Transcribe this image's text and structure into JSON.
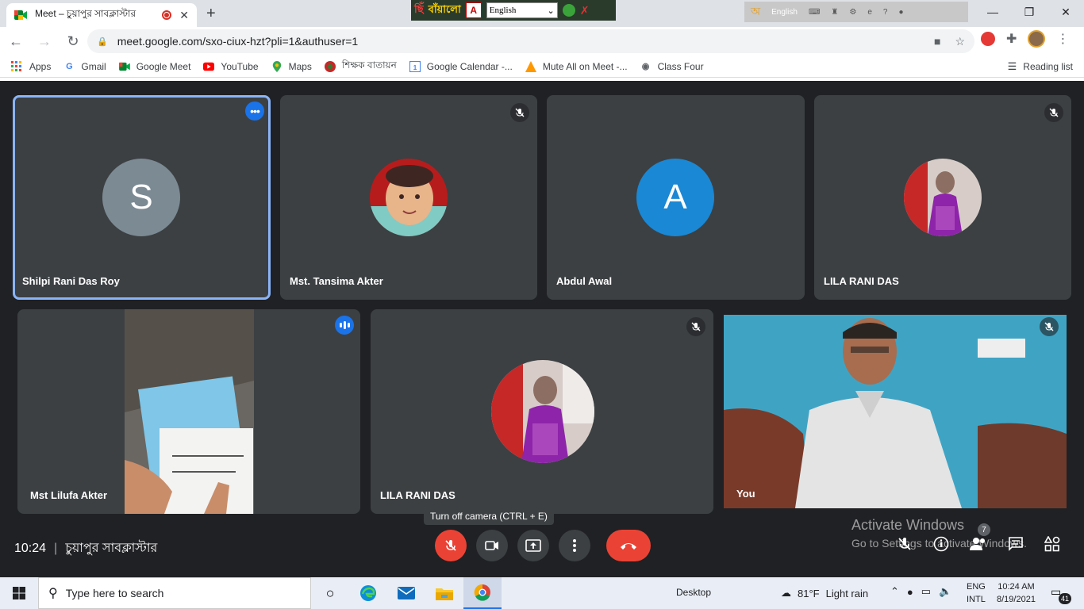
{
  "browser": {
    "tab_title": "Meet – চুয়াপুর সাবক্লাস্টার",
    "url": "meet.google.com/sxo-ciux-hzt?pli=1&authuser=1",
    "bn_select": "English",
    "ime_lang": "English",
    "bookmarks": [
      {
        "label": "Apps"
      },
      {
        "label": "Gmail"
      },
      {
        "label": "Google Meet"
      },
      {
        "label": "YouTube"
      },
      {
        "label": "Maps"
      },
      {
        "label": "শিক্ষক বাতায়ন"
      },
      {
        "label": "Google Calendar -..."
      },
      {
        "label": "Mute All on Meet -..."
      },
      {
        "label": "Class Four"
      }
    ],
    "reading_list": "Reading list"
  },
  "participants": [
    {
      "name": "Shilpi Rani Das Roy",
      "initial": "S",
      "color": "#7c8a94"
    },
    {
      "name": "Mst. Tansima Akter"
    },
    {
      "name": "Abdul Awal",
      "initial": "A",
      "color": "#1a88d4"
    },
    {
      "name": "LILA RANI DAS"
    },
    {
      "name": "Mst Lilufa Akter"
    },
    {
      "name": "LILA RANI DAS"
    },
    {
      "name": "You"
    }
  ],
  "meeting": {
    "time": "10:24",
    "title": "চুয়াপুর সাবক্লাস্টার",
    "tooltip": "Turn off camera (CTRL + E)",
    "people_count": "7"
  },
  "watermark": {
    "line1": "Activate Windows",
    "line2": "Go to Settings to activate Windows."
  },
  "taskbar": {
    "search_placeholder": "Type here to search",
    "desktop": "Desktop",
    "temperature": "81°F",
    "weather": "Light rain",
    "lang1": "ENG",
    "lang2": "INTL",
    "time": "10:24 AM",
    "date": "8/19/2021",
    "notifications": "41"
  }
}
